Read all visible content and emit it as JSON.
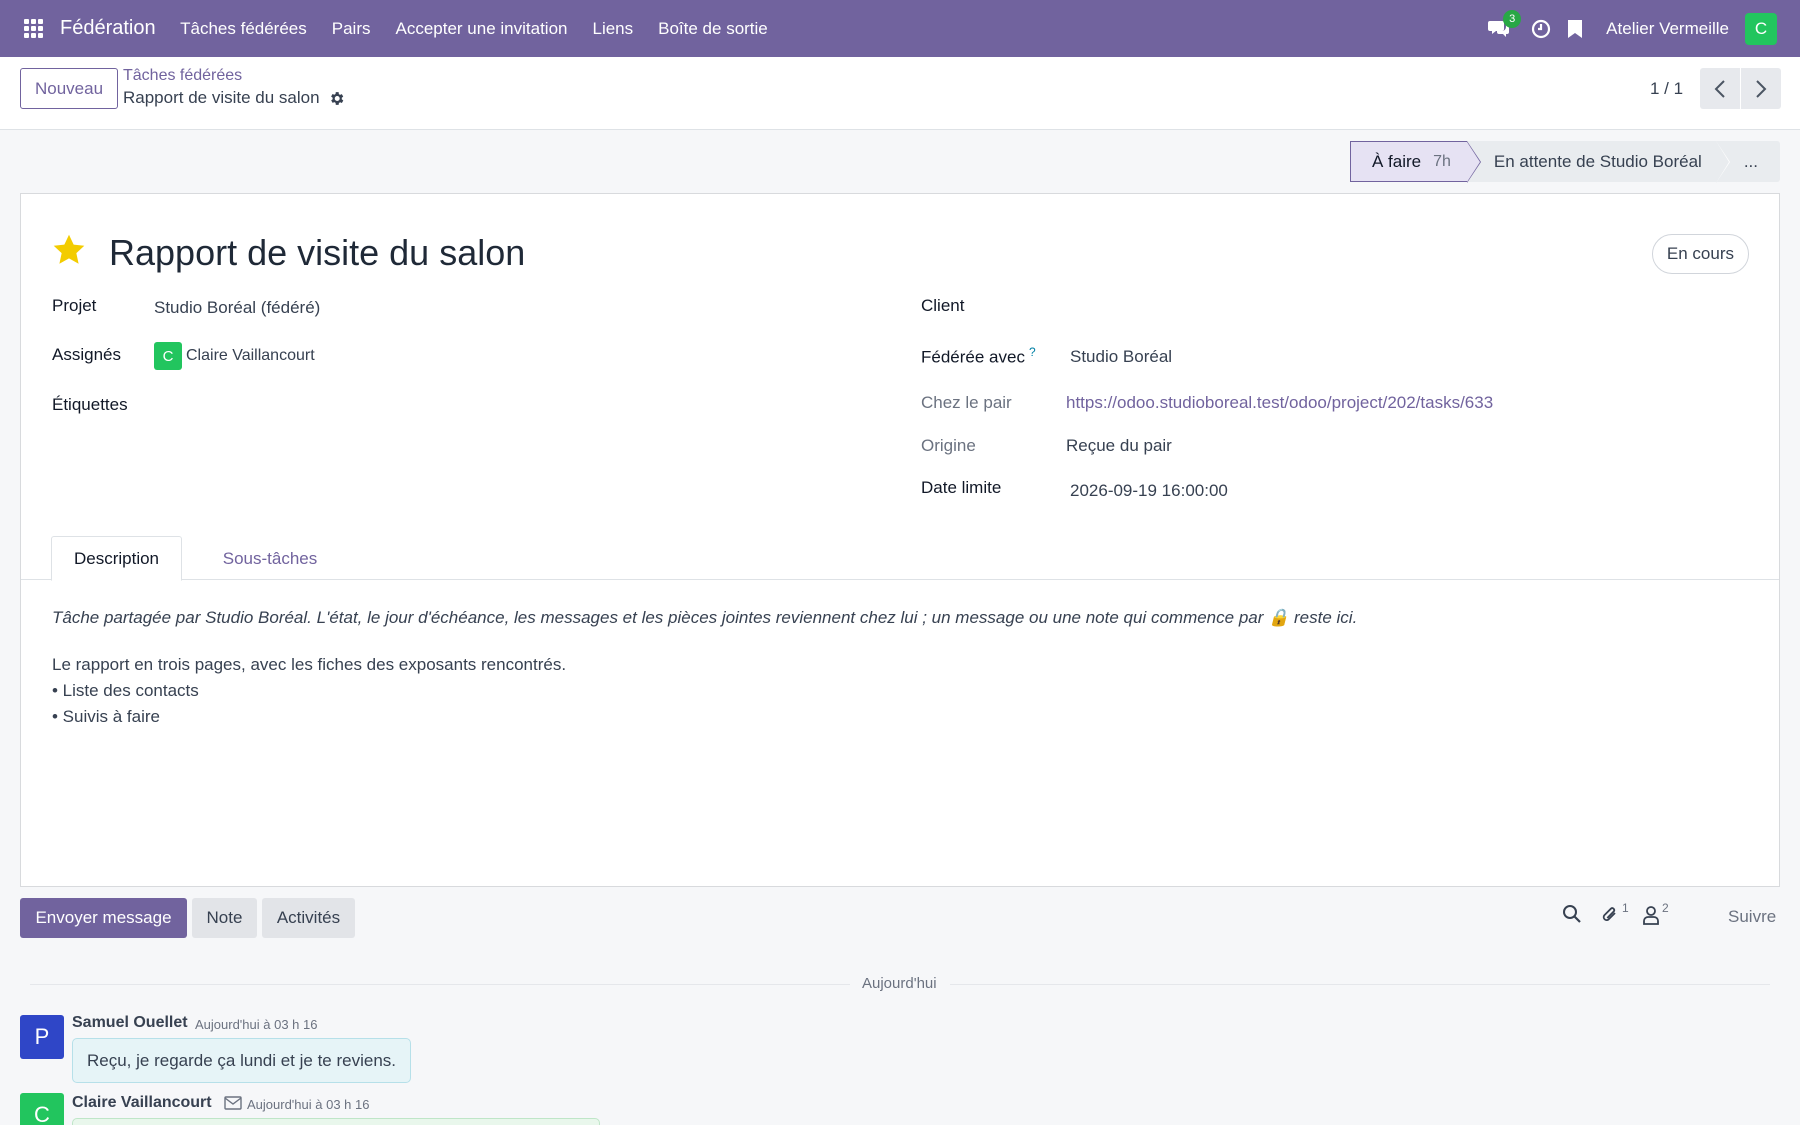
{
  "navbar": {
    "app_name": "Fédération",
    "menu": [
      "Tâches fédérées",
      "Pairs",
      "Accepter une invitation",
      "Liens",
      "Boîte de sortie"
    ],
    "messages_count": "3",
    "company": "Atelier Vermeille",
    "user_initial": "C",
    "bg_color": "#71639e"
  },
  "control_panel": {
    "new_button": "Nouveau",
    "breadcrumb_parent": "Tâches fédérées",
    "breadcrumb_current": "Rapport de visite du salon",
    "pager": "1 / 1"
  },
  "statusbar": {
    "active_stage": "À faire",
    "active_duration": "7h",
    "next_stage": "En attente de Studio Boréal",
    "more": "..."
  },
  "form": {
    "title": "Rapport de visite du salon",
    "starred": true,
    "state": "En cours",
    "left_fields": {
      "project_label": "Projet",
      "project_value": "Studio Boréal (fédéré)",
      "assignees_label": "Assignés",
      "assignee_initial": "C",
      "assignee_name": "Claire Vaillancourt",
      "tags_label": "Étiquettes"
    },
    "right_fields": {
      "client_label": "Client",
      "federated_label": "Fédérée avec",
      "federated_help": "?",
      "federated_value": "Studio Boréal",
      "peer_label": "Chez le pair",
      "peer_url": "https://odoo.studioboreal.test/odoo/project/202/tasks/633",
      "origin_label": "Origine",
      "origin_value": "Reçue du pair",
      "deadline_label": "Date limite",
      "deadline_value": "2026-09-19 16:00:00"
    },
    "tabs": [
      "Description",
      "Sous-tâches"
    ],
    "description": {
      "note": "Tâche partagée par Studio Boréal. L'état, le jour d'échéance, les messages et les pièces jointes reviennent chez lui ; un message ou une note qui commence par 🔒 reste ici.",
      "lines": [
        "Le rapport en trois pages, avec les fiches des exposants rencontrés.",
        "• Liste des contacts",
        "• Suivis à faire"
      ]
    }
  },
  "chatter": {
    "send_message": "Envoyer message",
    "note": "Note",
    "activities": "Activités",
    "attachments_count": "1",
    "followers_count": "2",
    "follow": "Suivre",
    "separator": "Aujourd'hui",
    "messages": [
      {
        "initial": "P",
        "avatar_color": "#2f46c7",
        "author": "Samuel Ouellet",
        "date": "Aujourd'hui à 03 h 16",
        "body": "Reçu, je regarde ça lundi et je te reviens."
      },
      {
        "initial": "C",
        "avatar_color": "#22c55e",
        "author": "Claire Vaillancourt",
        "date": "Aujourd'hui à 03 h 16",
        "icon": "envelope-icon"
      }
    ]
  }
}
